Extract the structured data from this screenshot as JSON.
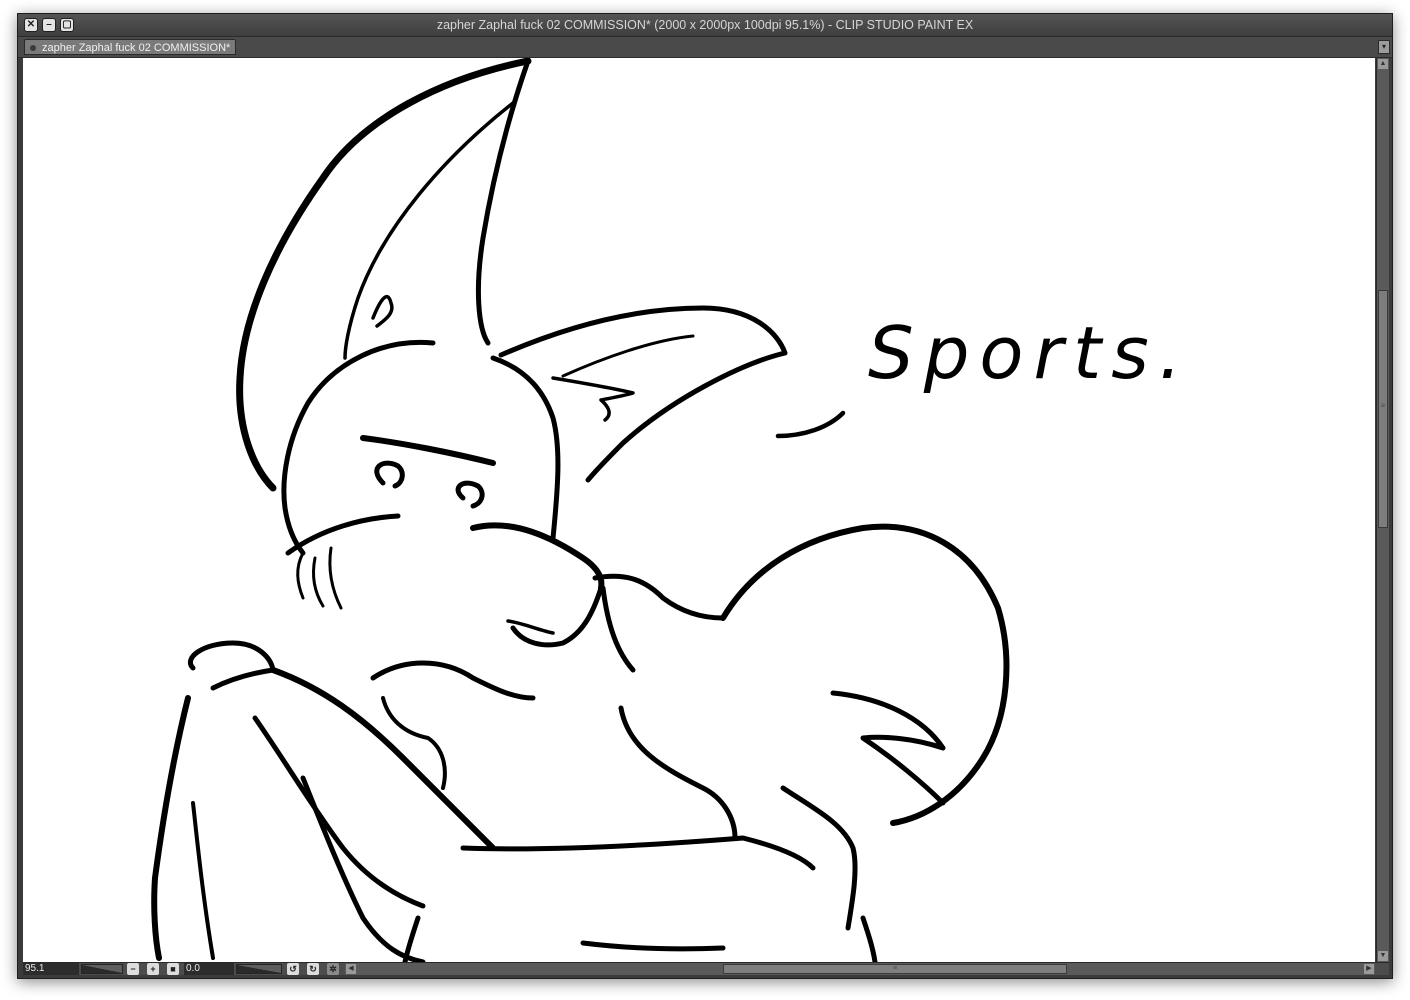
{
  "window": {
    "title": "zapher Zaphal fuck 02 COMMISSION* (2000 x 2000px 100dpi 95.1%)  - CLIP STUDIO PAINT EX",
    "controls": {
      "close": "✕",
      "minimize": "–",
      "maximize": "▢"
    }
  },
  "tab": {
    "label": "zapher Zaphal fuck 02 COMMISSION*",
    "menu_icon": "▾"
  },
  "canvas": {
    "text_annotation": "Sports."
  },
  "statusbar": {
    "zoom_value": "95.1",
    "rotation_value": "0.0",
    "icons": {
      "zoom_out": "−",
      "zoom_in": "+",
      "fit": "■",
      "rotate_left": "↺",
      "rotate_right": "↻",
      "reset_rotation": "✲"
    }
  },
  "scrollbar": {
    "up_arrow": "▲",
    "down_arrow": "▼",
    "left_arrow": "◀",
    "right_arrow": "▶",
    "grip": "≡"
  }
}
